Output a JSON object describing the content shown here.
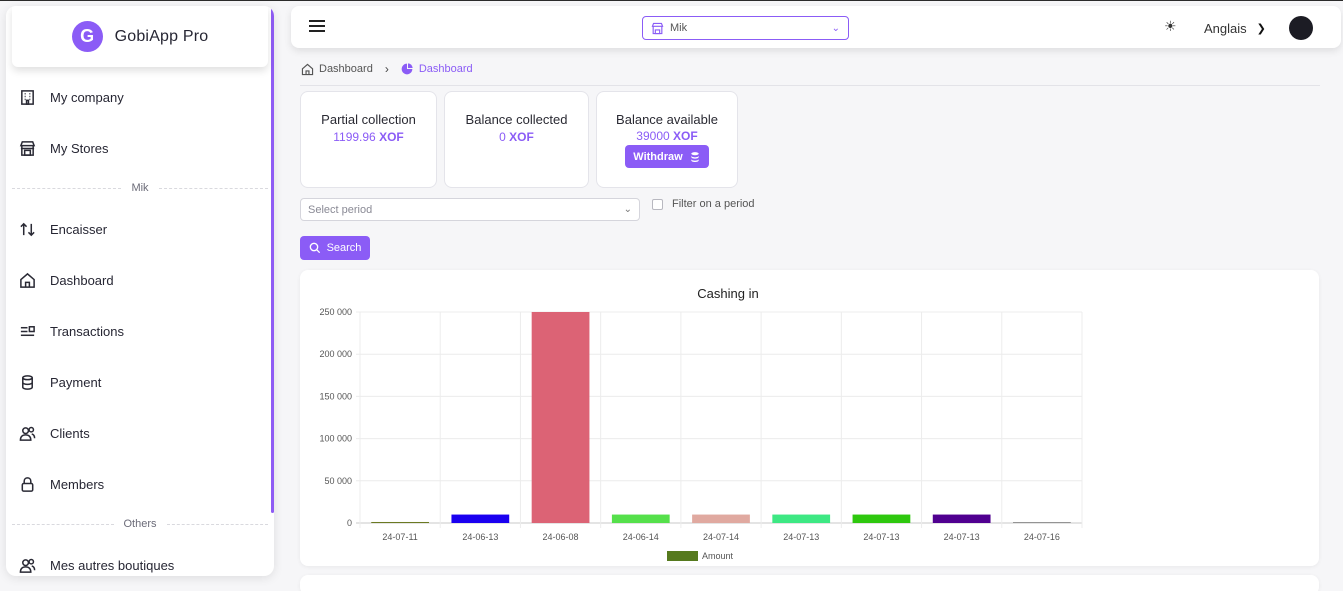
{
  "app": {
    "name": "GobiApp Pro",
    "logo_letter": "G"
  },
  "sidebar": {
    "items_top": [
      {
        "label": "My company",
        "icon": "building-icon"
      },
      {
        "label": "My Stores",
        "icon": "store-icon"
      }
    ],
    "section_store": "Mik",
    "items_store": [
      {
        "label": "Encaisser",
        "icon": "arrows-updown-icon"
      },
      {
        "label": "Dashboard",
        "icon": "home-icon"
      },
      {
        "label": "Transactions",
        "icon": "list-icon"
      },
      {
        "label": "Payment",
        "icon": "database-icon"
      },
      {
        "label": "Clients",
        "icon": "users-icon"
      },
      {
        "label": "Members",
        "icon": "lock-icon"
      }
    ],
    "section_others": "Others",
    "items_others": [
      {
        "label": "Mes autres boutiques",
        "icon": "users-icon"
      }
    ]
  },
  "header": {
    "store_selected": "Mik",
    "language": "Anglais",
    "theme_icon": "sun-icon"
  },
  "breadcrumb": {
    "home": "Dashboard",
    "current": "Dashboard"
  },
  "stats": [
    {
      "title": "Partial collection",
      "amount": "1199.96",
      "currency": "XOF"
    },
    {
      "title": "Balance collected",
      "amount": "0",
      "currency": "XOF"
    },
    {
      "title": "Balance available",
      "amount": "39000",
      "currency": "XOF",
      "action": "Withdraw"
    }
  ],
  "filters": {
    "period_placeholder": "Select period",
    "filter_label": "Filter on a period",
    "search_label": "Search"
  },
  "chart_data": {
    "type": "bar",
    "title": "Cashing in",
    "categories": [
      "24-07-11",
      "24-06-13",
      "24-06-08",
      "24-06-14",
      "24-07-14",
      "24-07-13",
      "24-07-13",
      "24-07-13",
      "24-07-16"
    ],
    "series": [
      {
        "name": "Amount",
        "values": [
          1200,
          10000,
          250000,
          10000,
          10000,
          10000,
          10000,
          10000,
          500
        ]
      }
    ],
    "bar_colors": [
      "#6b7a22",
      "#1a00f0",
      "#dc6375",
      "#55e04b",
      "#e0a9a0",
      "#3de883",
      "#2ec80e",
      "#500090",
      "#7a7a7a"
    ],
    "legend_color": "#567a1e",
    "yticks": [
      "0",
      "50 000",
      "100 000",
      "150 000",
      "200 000",
      "250 000"
    ],
    "ylim": [
      0,
      250000
    ],
    "grid": true,
    "legend_position": "bottom"
  }
}
